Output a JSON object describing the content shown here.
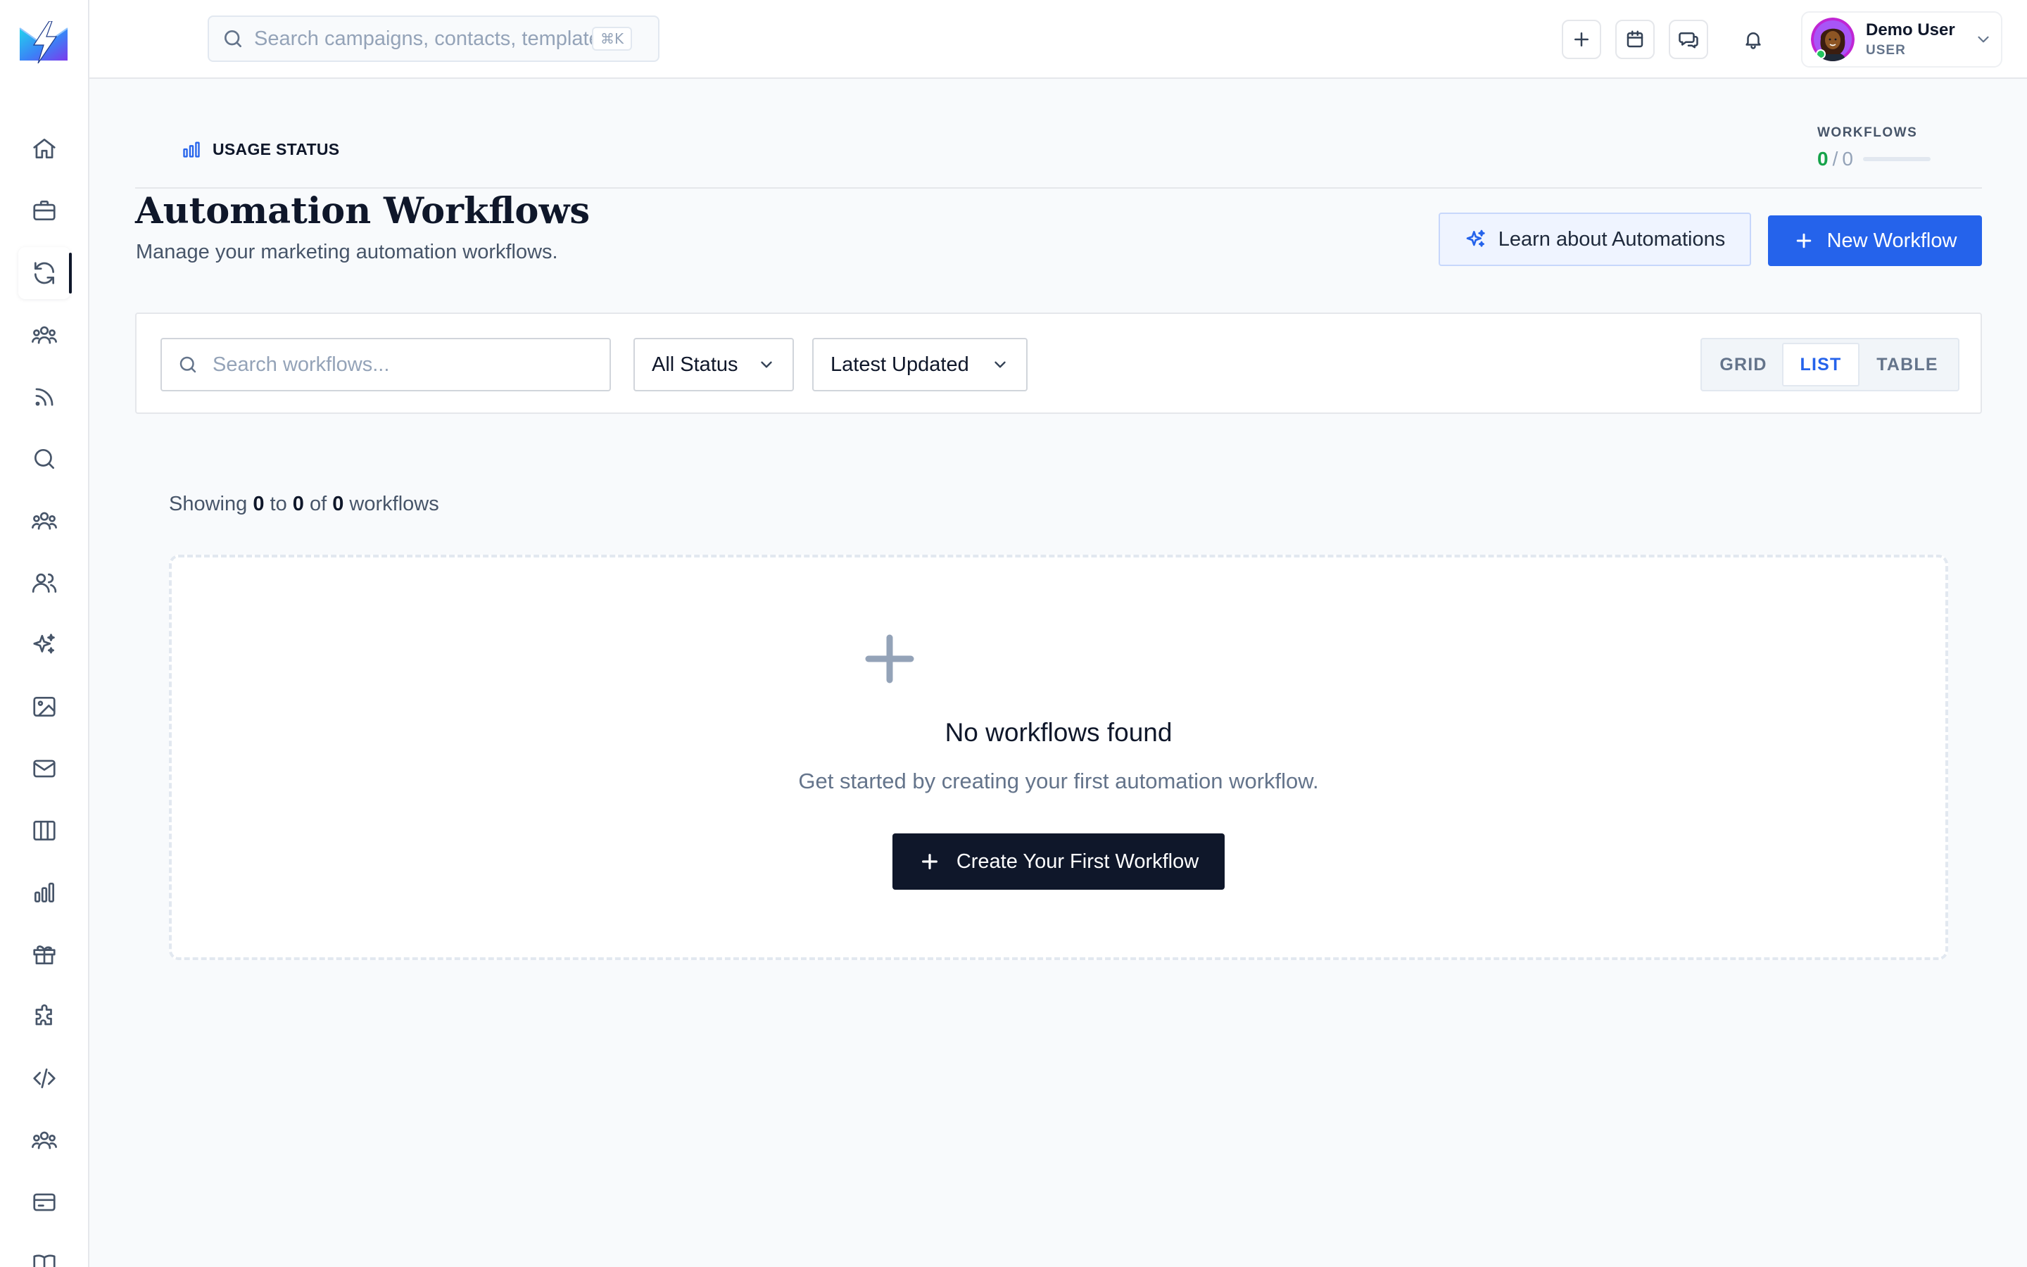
{
  "topbar": {
    "search_placeholder": "Search campaigns, contacts, templates...",
    "search_shortcut": "⌘K",
    "actions": [
      "plus-icon",
      "calendar-icon",
      "chat-icon",
      "bell-icon"
    ]
  },
  "user": {
    "name": "Demo User",
    "role": "USER"
  },
  "sidebar": {
    "items": [
      {
        "name": "dashboard",
        "icon": "home-icon"
      },
      {
        "name": "campaigns",
        "icon": "briefcase-icon"
      },
      {
        "name": "automations",
        "icon": "refresh-icon",
        "active": true
      },
      {
        "name": "audiences",
        "icon": "users-group-icon"
      },
      {
        "name": "feeds",
        "icon": "rss-icon"
      },
      {
        "name": "search",
        "icon": "search-icon"
      },
      {
        "name": "segments",
        "icon": "users-group-icon"
      },
      {
        "name": "contacts",
        "icon": "users-icon"
      },
      {
        "name": "ai-tools",
        "icon": "sparkles-icon"
      },
      {
        "name": "media",
        "icon": "image-icon"
      },
      {
        "name": "emails",
        "icon": "mail-icon"
      },
      {
        "name": "templates",
        "icon": "columns-icon"
      },
      {
        "name": "analytics",
        "icon": "bar-chart-icon"
      },
      {
        "name": "rewards",
        "icon": "gift-icon"
      },
      {
        "name": "integrations",
        "icon": "puzzle-icon"
      },
      {
        "name": "developer",
        "icon": "code-icon"
      },
      {
        "name": "team",
        "icon": "users-group-icon"
      },
      {
        "name": "billing",
        "icon": "credit-card-icon"
      },
      {
        "name": "docs",
        "icon": "book-icon"
      }
    ]
  },
  "usage": {
    "label": "USAGE STATUS",
    "workflows_label": "WORKFLOWS",
    "used": "0",
    "separator": "/",
    "limit": "0",
    "fraction_used": 0
  },
  "header": {
    "title": "Automation Workflows",
    "subtitle": "Manage your marketing automation workflows.",
    "learn_label": "Learn about Automations",
    "new_label": "New Workflow"
  },
  "filters": {
    "search_placeholder": "Search workflows...",
    "status_value": "All Status",
    "sort_value": "Latest Updated",
    "views": [
      "GRID",
      "LIST",
      "TABLE"
    ],
    "active_view": "LIST"
  },
  "results": {
    "showing_prefix": "Showing",
    "from": "0",
    "to_word": "to",
    "to": "0",
    "of_word": "of",
    "total": "0",
    "suffix": "workflows"
  },
  "empty": {
    "title": "No workflows found",
    "description": "Get started by creating your first automation workflow.",
    "cta_label": "Create Your First Workflow"
  },
  "colors": {
    "primary": "#2563eb",
    "dark": "#0f172a",
    "success": "#16a34a",
    "muted": "#64748b"
  }
}
